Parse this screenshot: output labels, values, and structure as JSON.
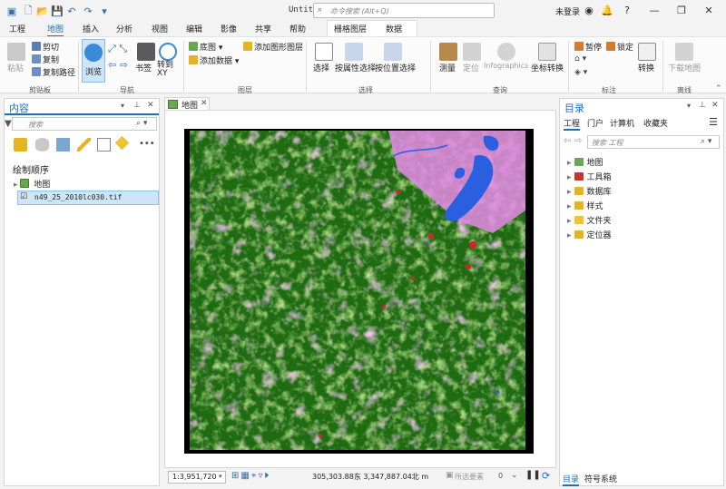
{
  "window": {
    "title": "Untitled",
    "command_search_placeholder": "命令搜索 (Alt+Q)",
    "login_label": "未登录"
  },
  "ribbon_tabs": [
    "工程",
    "地图",
    "插入",
    "分析",
    "视图",
    "编辑",
    "影像",
    "共享",
    "帮助"
  ],
  "active_tab": "地图",
  "context_tabs": [
    "栅格图层",
    "数据"
  ],
  "ribbon": {
    "clipboard": {
      "paste": "粘贴",
      "cut": "剪切",
      "copy": "复制",
      "copy_path": "复制路径",
      "label": "剪贴板"
    },
    "navigate": {
      "explore": "浏览",
      "bookmarks": "书签",
      "goto_xy": "转到 XY",
      "label": "导航"
    },
    "layer": {
      "basemap": "底图",
      "add_data": "添加数据",
      "add_graphics_layer": "添加图形图层",
      "label": "图层"
    },
    "selection": {
      "select": "选择",
      "select_by_attributes": "按属性选择",
      "select_by_location": "按位置选择",
      "label": "选择"
    },
    "inquiry": {
      "measure": "测量",
      "locate": "定位",
      "infographics": "Infographics",
      "coordinate_conversion": "坐标转换",
      "label": "查询"
    },
    "labeling": {
      "pause": "暂停",
      "lock": "锁定",
      "convert": "转换",
      "label": "标注"
    },
    "offline": {
      "download_map": "下载地图",
      "label": "离线"
    }
  },
  "contents_pane": {
    "title": "内容",
    "search_placeholder": "搜索",
    "drawing_order_label": "绘制顺序",
    "map_node": "地图",
    "layer_name": "n49_25_2010lc030.tif"
  },
  "map_view": {
    "tab_label": "地图"
  },
  "status_bar": {
    "scale": "1:3,951,720",
    "coordinates": "305,303.88东 3,347,887.04北 m",
    "selected_features": "所选要素",
    "selected_count": "0"
  },
  "catalog_pane": {
    "title": "目录",
    "tabs": [
      "工程",
      "门户",
      "计算机",
      "收藏夹"
    ],
    "search_placeholder": "搜索 工程",
    "items": [
      "地图",
      "工具箱",
      "数据库",
      "样式",
      "文件夹",
      "定位器"
    ],
    "bottom_tabs": [
      "目录",
      "符号系统"
    ]
  },
  "colors": {
    "accent": "#1c6fc4",
    "forest": "#1f6b12",
    "grassland": "#8fd44a",
    "urban": "#e58ae6",
    "water": "#2a5fe0",
    "built_up": "#d4212b"
  }
}
